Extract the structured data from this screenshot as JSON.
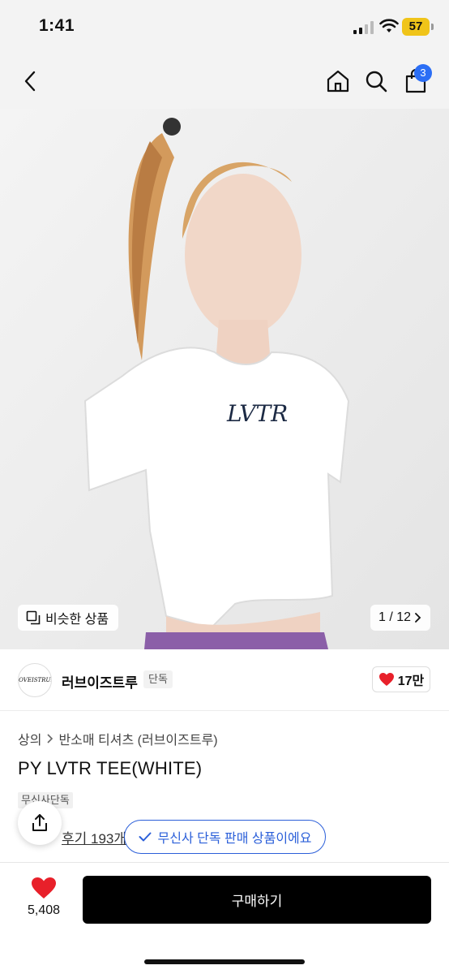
{
  "status_bar": {
    "time": "1:41",
    "battery": "57"
  },
  "nav": {
    "cart_count": "3",
    "icons": [
      "back-icon",
      "home-icon",
      "search-icon",
      "bag-icon"
    ]
  },
  "gallery": {
    "similar_label": "비슷한 상품",
    "counter": "1 / 12"
  },
  "brand": {
    "logo_text": "LOVEISTRUE",
    "name": "러브이즈트루",
    "tag": "단독",
    "likes": "17만"
  },
  "product": {
    "breadcrumb_category": "상의",
    "breadcrumb_sub": "반소매 티셔츠 (러브이즈트루)",
    "title": "PY LVTR TEE(WHITE)",
    "exclusive_tag": "무신사단독",
    "review_link": "후기 193개"
  },
  "toast": {
    "message": "무신사 단독 판매 상품이에요"
  },
  "bottom_bar": {
    "like_count": "5,408",
    "buy_label": "구매하기"
  },
  "colors": {
    "accent_blue": "#2b5fd9",
    "badge_blue": "#2b6ef5",
    "heart_red": "#e8202a",
    "buy_button": "#000000"
  }
}
